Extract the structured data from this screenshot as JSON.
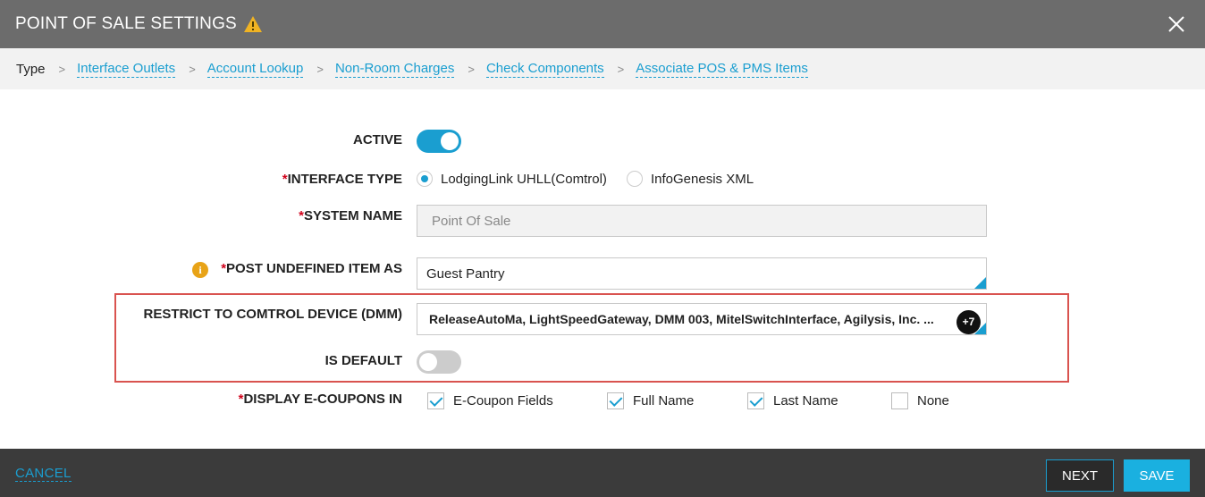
{
  "dialog": {
    "title": "POINT OF SALE SETTINGS",
    "warning_icon": "warning-triangle-icon",
    "close_icon": "close-icon"
  },
  "breadcrumb": {
    "current": "Type",
    "separator": ">",
    "links": [
      "Interface Outlets",
      "Account Lookup",
      "Non-Room Charges",
      "Check Components",
      "Associate POS & PMS Items"
    ]
  },
  "form": {
    "active": {
      "label": "ACTIVE",
      "on": true
    },
    "interface_type": {
      "required": "*",
      "label": "INTERFACE TYPE",
      "options": [
        "LodgingLink UHLL(Comtrol)",
        "InfoGenesis XML"
      ],
      "selected": "LodgingLink UHLL(Comtrol)"
    },
    "system_name": {
      "required": "*",
      "label": "SYSTEM NAME",
      "placeholder": "Point Of Sale"
    },
    "post_undefined": {
      "info_icon": "info-icon",
      "info_glyph": "i",
      "required": "*",
      "label": "POST UNDEFINED ITEM AS",
      "value": "Guest Pantry"
    },
    "restrict_device": {
      "label": "RESTRICT TO COMTROL DEVICE (DMM)",
      "value": "ReleaseAutoMa, LightSpeedGateway, DMM 003, MitelSwitchInterface, Agilysis, Inc. ...",
      "more_count": "+7"
    },
    "is_default": {
      "label": "IS DEFAULT",
      "on": false
    },
    "display_ecoupons": {
      "required": "*",
      "label": "DISPLAY E-COUPONS IN",
      "options": [
        {
          "label": "E-Coupon Fields",
          "checked": true
        },
        {
          "label": "Full Name",
          "checked": true
        },
        {
          "label": "Last Name",
          "checked": true
        },
        {
          "label": "None",
          "checked": false
        }
      ]
    }
  },
  "footer": {
    "cancel": "CANCEL",
    "next": "NEXT",
    "save": "SAVE"
  },
  "colors": {
    "accent": "#1a9ed0",
    "header": "#6c6c6c",
    "footer": "#3b3b3b",
    "highlight": "#d9534f",
    "warning": "#e8a317"
  }
}
